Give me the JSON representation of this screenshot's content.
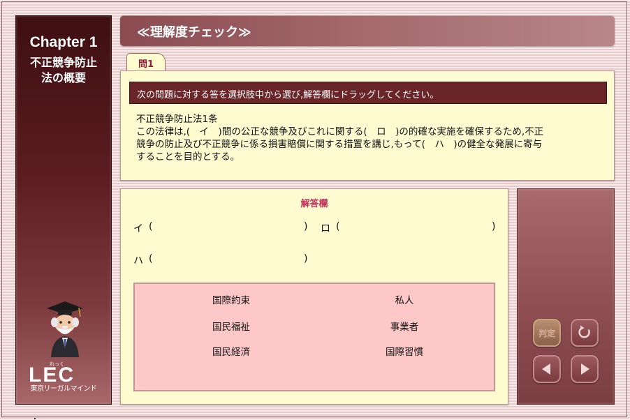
{
  "sidebar": {
    "chapter": "Chapter 1",
    "chapter_title_line1": "不正競争防止",
    "chapter_title_line2": "法の概要",
    "logo_text": "LEC",
    "logo_ruby": "れっく",
    "tagline": "東京リーガルマインド"
  },
  "header": {
    "title": "≪理解度チェック≫"
  },
  "tab": {
    "label": "問1"
  },
  "question": {
    "instruction": "次の問題に対する答を選択肢中から選び,解答欄にドラッグしてください。",
    "lines": [
      "不正競争防止法1条",
      "この法律は,(　イ　)間の公正な競争及びこれに関する(　ロ　)の的確な実施を確保するため,不正",
      "競争の防止及び不正競争に係る損害賠償に関する措置を講じ,もって(　ハ　)の健全な発展に寄与",
      "することを目的とする。"
    ]
  },
  "answer": {
    "heading": "解答欄",
    "slot_i": "イ",
    "slot_ro": "ロ",
    "slot_ha": "ハ",
    "open_paren": "(",
    "close_paren": ")"
  },
  "choices": [
    "国際約束",
    "私人",
    "国民福祉",
    "事業者",
    "国民経済",
    "国際習慣"
  ],
  "controls": {
    "judge_label": "判定"
  },
  "colors": {
    "sidebar_dark": "#3e0f12",
    "panel_yellow": "#fffbd0",
    "choices_pink": "#ffc8c8",
    "accent_red": "#c0335a",
    "instruction_bar": "#6a2528"
  }
}
